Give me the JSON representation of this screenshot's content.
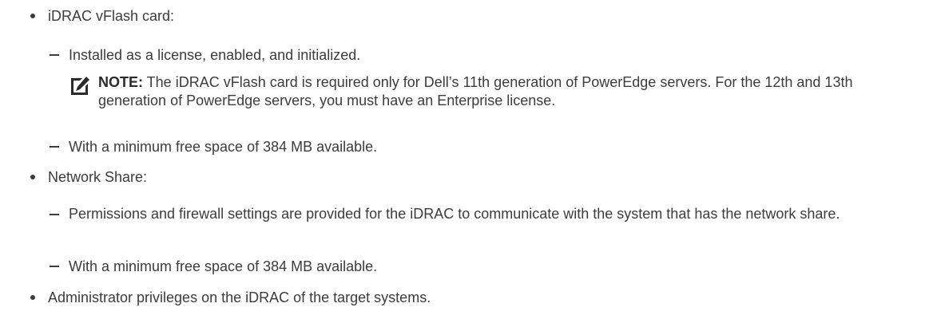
{
  "items": [
    {
      "text": "iDRAC vFlash card:",
      "subitems": [
        {
          "text": "Installed as a license, enabled, and initialized.",
          "note": {
            "label": "NOTE:",
            "text": " The iDRAC vFlash card is required only for Dell’s 11th generation of PowerEdge servers. For the 12th and 13th generation of PowerEdge servers, you must have an Enterprise license."
          }
        },
        {
          "text": "With a minimum free space of 384 MB available."
        }
      ]
    },
    {
      "text": "Network Share:",
      "subitems": [
        {
          "text": "Permissions and firewall settings are provided for the iDRAC to communicate with the system that has the network share."
        },
        {
          "text": "With a minimum free space of 384 MB available."
        }
      ]
    },
    {
      "text": "Administrator privileges on the iDRAC of the target systems."
    }
  ],
  "icons": {
    "note": "pencil-note-icon"
  }
}
